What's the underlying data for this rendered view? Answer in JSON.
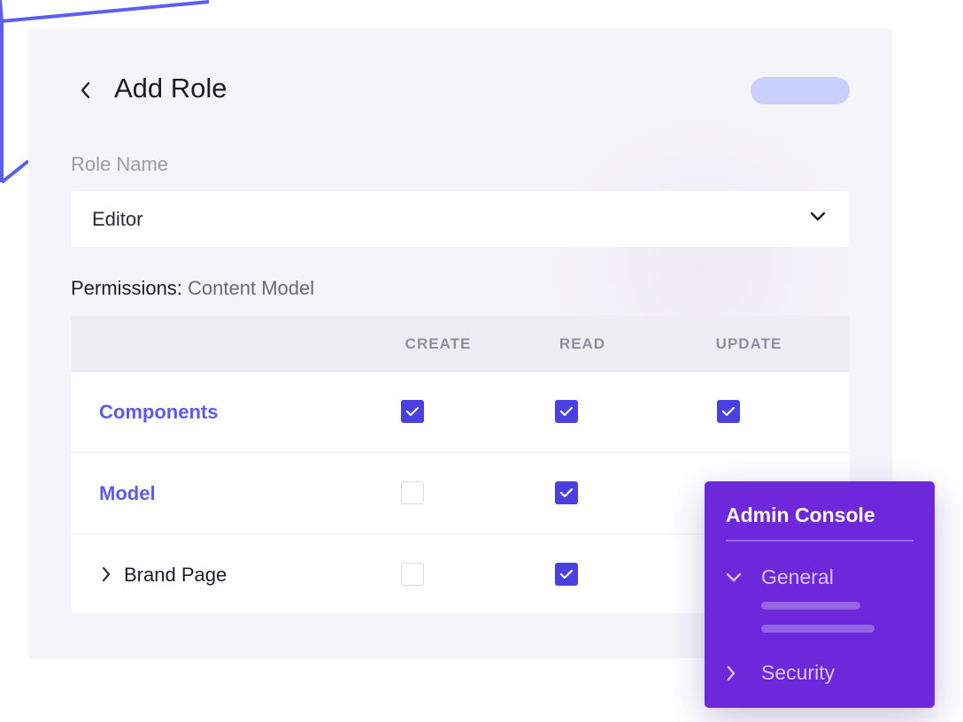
{
  "header": {
    "title": "Add Role",
    "back_icon": "chevron-left-icon"
  },
  "role_field": {
    "label": "Role Name",
    "value": "Editor",
    "chevron_icon": "chevron-down-icon"
  },
  "permissions": {
    "heading": "Permissions:",
    "subject": "Content Model",
    "columns": [
      "CREATE",
      "READ",
      "UPDATE"
    ],
    "rows": [
      {
        "label": "Components",
        "create": true,
        "read": true,
        "update": true
      },
      {
        "label": "Model",
        "create": false,
        "read": true
      },
      {
        "label": "Brand Page",
        "create": false,
        "read": true
      }
    ]
  },
  "console": {
    "title": "Admin Console",
    "items": [
      {
        "label": "General",
        "expanded": true
      },
      {
        "label": "Security",
        "expanded": false
      }
    ]
  },
  "colors": {
    "accent": "#5e5bea",
    "checkbox_checked": "#4a3fe0",
    "console_bg": "#6f27dc",
    "pill": "#c8d0fb"
  }
}
